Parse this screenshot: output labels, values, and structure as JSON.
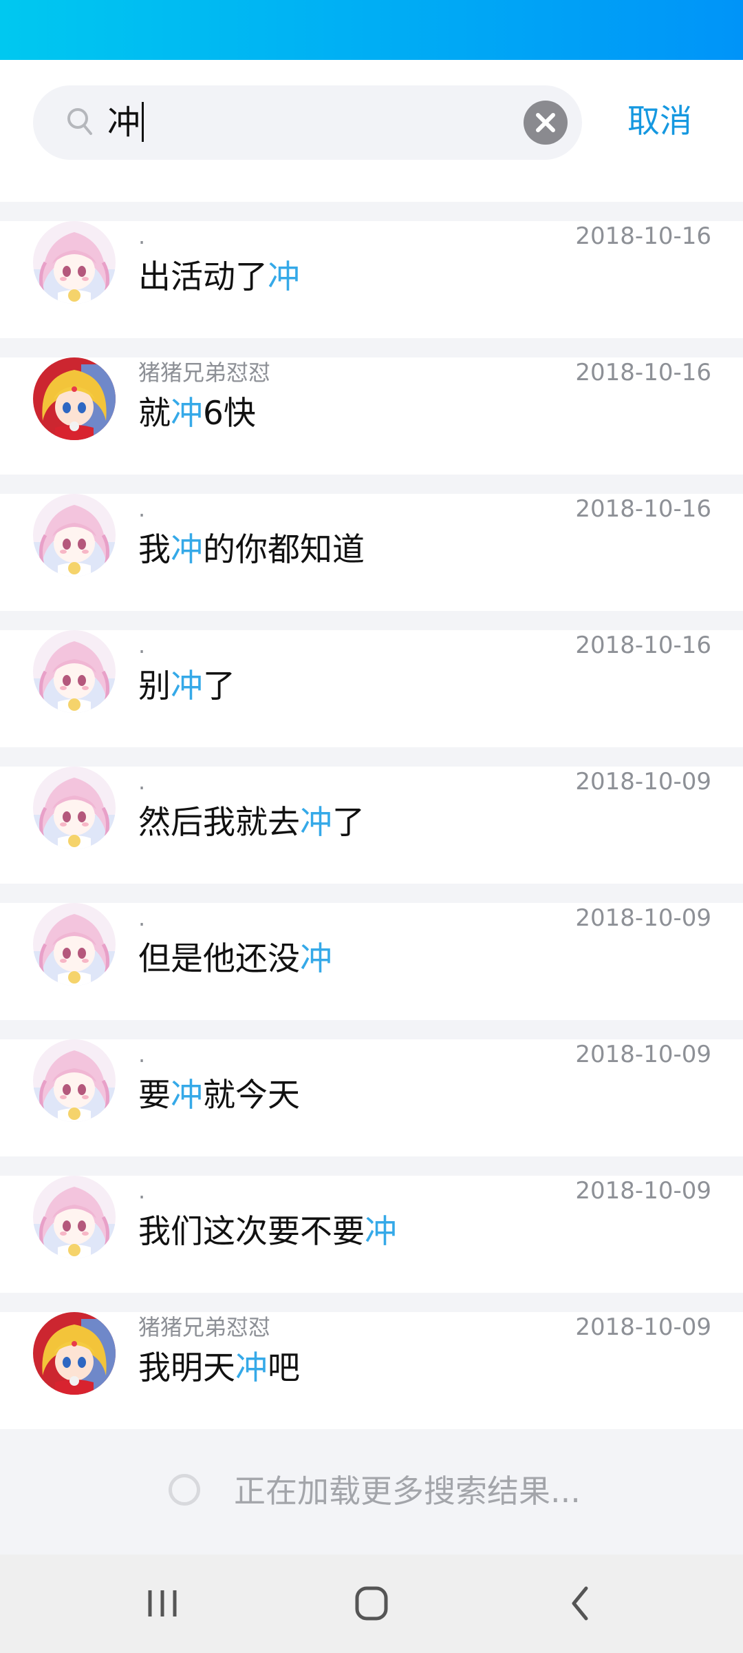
{
  "search": {
    "query": "冲"
  },
  "cancel_label": "取消",
  "results": [
    {
      "sender": ".",
      "time": "2018-10-16",
      "pre": "出活动了",
      "hit": "冲",
      "post": "",
      "avatar": "pink-girl-avatar"
    },
    {
      "sender": "猪猪兄弟怼怼",
      "time": "2018-10-16",
      "pre": "就",
      "hit": "冲",
      "post": "6快",
      "avatar": "sailor-avatar"
    },
    {
      "sender": ".",
      "time": "2018-10-16",
      "pre": "我",
      "hit": "冲",
      "post": "的你都知道",
      "avatar": "pink-girl-avatar"
    },
    {
      "sender": ".",
      "time": "2018-10-16",
      "pre": "别",
      "hit": "冲",
      "post": "了",
      "avatar": "pink-girl-avatar"
    },
    {
      "sender": ".",
      "time": "2018-10-09",
      "pre": "然后我就去",
      "hit": "冲",
      "post": "了",
      "avatar": "pink-girl-avatar"
    },
    {
      "sender": ".",
      "time": "2018-10-09",
      "pre": "但是他还没",
      "hit": "冲",
      "post": "",
      "avatar": "pink-girl-avatar"
    },
    {
      "sender": ".",
      "time": "2018-10-09",
      "pre": "要",
      "hit": "冲",
      "post": "就今天",
      "avatar": "pink-girl-avatar"
    },
    {
      "sender": ".",
      "time": "2018-10-09",
      "pre": "我们这次要不要",
      "hit": "冲",
      "post": "",
      "avatar": "pink-girl-avatar"
    },
    {
      "sender": "猪猪兄弟怼怼",
      "time": "2018-10-09",
      "pre": "我明天",
      "hit": "冲",
      "post": "吧",
      "avatar": "sailor-avatar"
    }
  ],
  "loading_text": "正在加载更多搜索结果...",
  "colors": {
    "accent": "#1598e0",
    "highlight": "#35a9e8",
    "status_gradient_start": "#00c8f0",
    "status_gradient_end": "#0094f8"
  },
  "nav": {
    "icons": [
      "recent-apps-icon",
      "home-icon",
      "back-icon"
    ]
  }
}
